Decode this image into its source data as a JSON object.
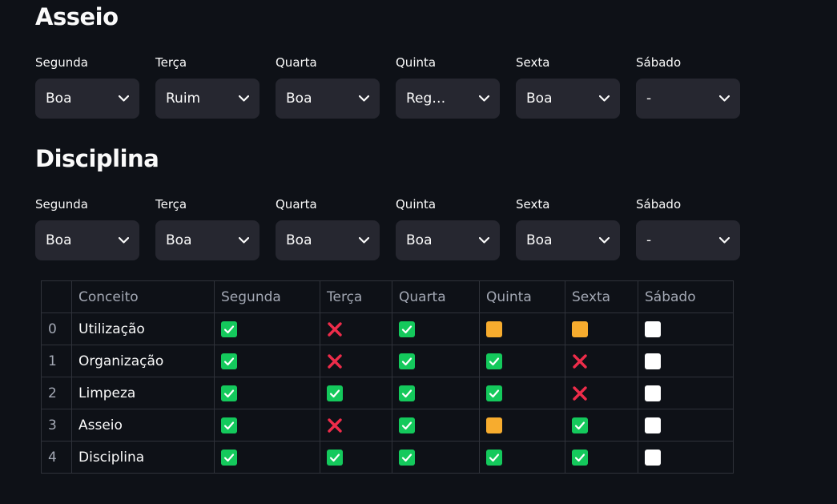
{
  "sections": [
    {
      "title": "Asseio",
      "selects": [
        {
          "label": "Segunda",
          "value": "Boa"
        },
        {
          "label": "Terça",
          "value": "Ruim"
        },
        {
          "label": "Quarta",
          "value": "Boa"
        },
        {
          "label": "Quinta",
          "value": "Reg…"
        },
        {
          "label": "Sexta",
          "value": "Boa"
        },
        {
          "label": "Sábado",
          "value": "-"
        }
      ]
    },
    {
      "title": "Disciplina",
      "selects": [
        {
          "label": "Segunda",
          "value": "Boa"
        },
        {
          "label": "Terça",
          "value": "Boa"
        },
        {
          "label": "Quarta",
          "value": "Boa"
        },
        {
          "label": "Quinta",
          "value": "Boa"
        },
        {
          "label": "Sexta",
          "value": "Boa"
        },
        {
          "label": "Sábado",
          "value": "-"
        }
      ]
    }
  ],
  "table": {
    "headers": [
      "",
      "Conceito",
      "Segunda",
      "Terça",
      "Quarta",
      "Quinta",
      "Sexta",
      "Sábado"
    ],
    "rows": [
      {
        "index": "0",
        "concept": "Utilização",
        "marks": [
          "check",
          "cross",
          "check",
          "square",
          "square",
          "empty"
        ]
      },
      {
        "index": "1",
        "concept": "Organização",
        "marks": [
          "check",
          "cross",
          "check",
          "check",
          "cross",
          "empty"
        ]
      },
      {
        "index": "2",
        "concept": "Limpeza",
        "marks": [
          "check",
          "check",
          "check",
          "check",
          "cross",
          "empty"
        ]
      },
      {
        "index": "3",
        "concept": "Asseio",
        "marks": [
          "check",
          "cross",
          "check",
          "square",
          "check",
          "empty"
        ]
      },
      {
        "index": "4",
        "concept": "Disciplina",
        "marks": [
          "check",
          "check",
          "check",
          "check",
          "check",
          "empty"
        ]
      }
    ]
  },
  "colors": {
    "background": "#0e1117",
    "select_bg": "#262730",
    "check": "#14c95c",
    "cross": "#ee2c4a",
    "square": "#f7ac2e",
    "empty": "#ffffff"
  },
  "icons": {
    "chevron": "chevron-down-icon",
    "check": "check-mark-icon",
    "cross": "cross-mark-icon",
    "square": "orange-square-icon",
    "empty": "white-square-icon"
  }
}
